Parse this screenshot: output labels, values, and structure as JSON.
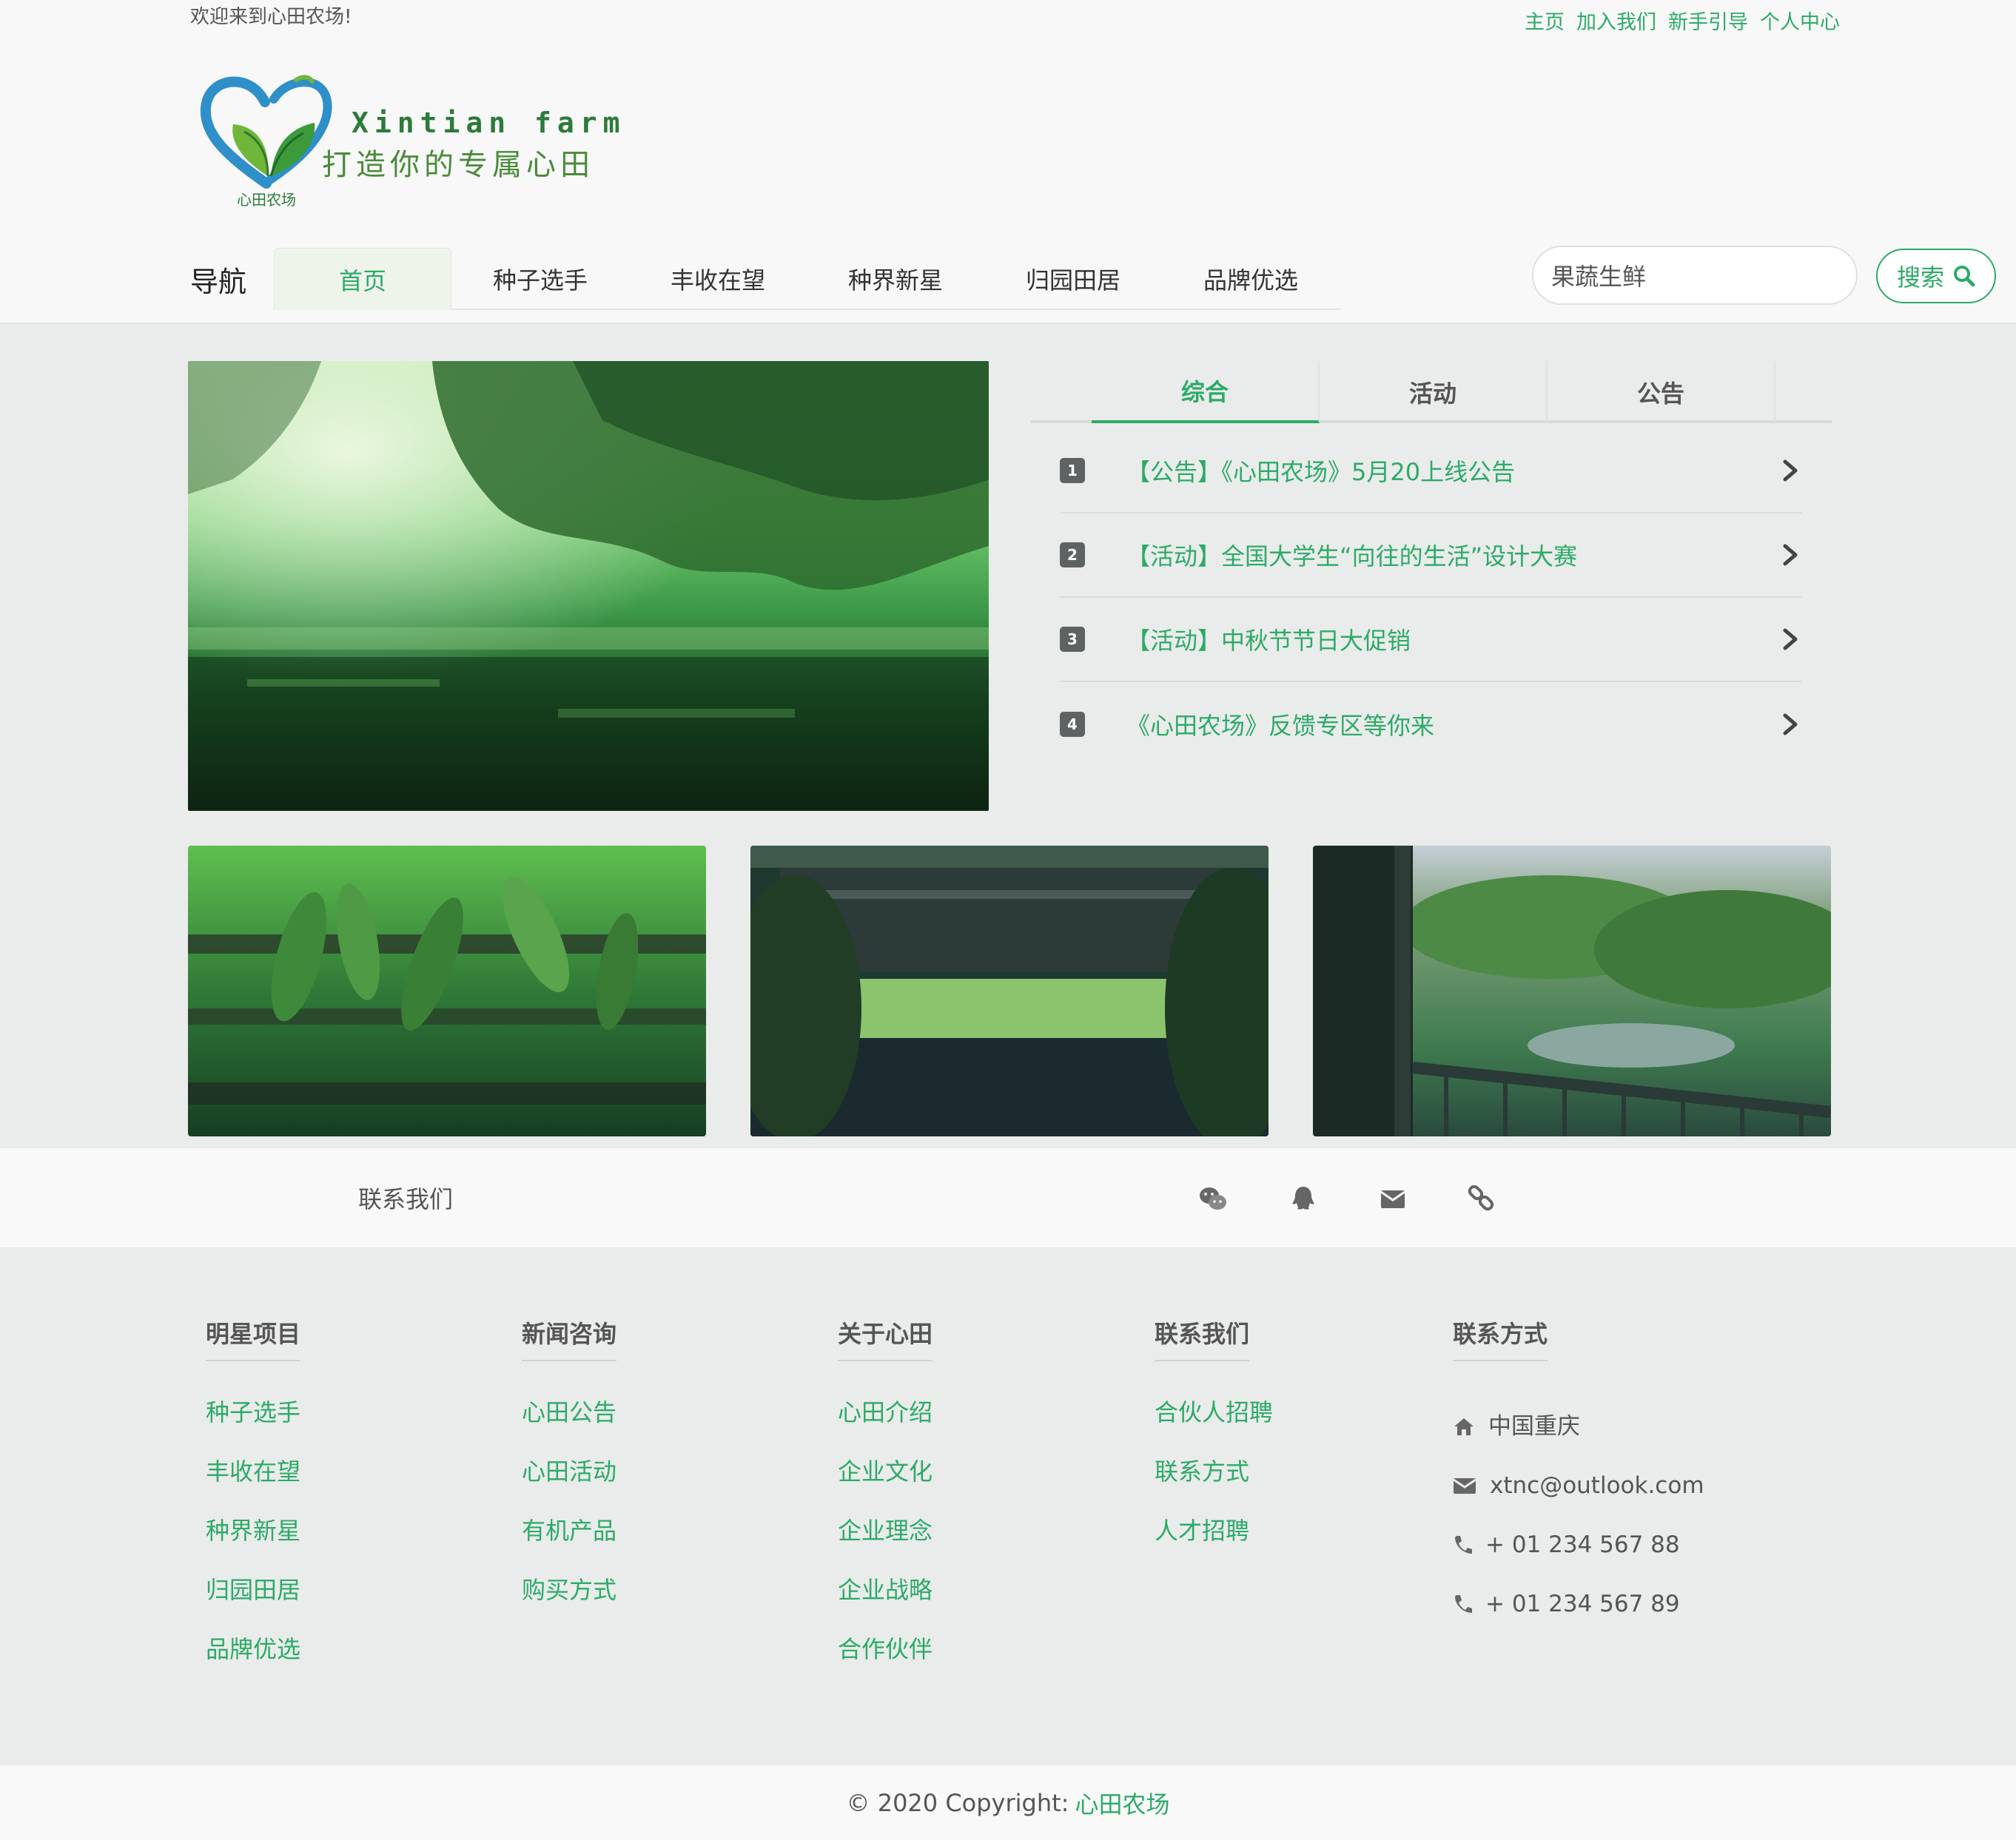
{
  "header": {
    "welcome": "欢迎来到心田农场!",
    "top_links": [
      "主页",
      "加入我们",
      "新手引导",
      "个人中心"
    ],
    "logo": {
      "en": "Xintian farm",
      "slogan": "打造你的专属心田",
      "sub": "心田农场"
    },
    "nav_label": "导航",
    "nav": [
      "首页",
      "种子选手",
      "丰收在望",
      "种界新星",
      "归园田居",
      "品牌优选"
    ],
    "active_nav": "首页",
    "search": {
      "value": "果蔬生鲜",
      "button": "搜索"
    }
  },
  "tabs": [
    "综合",
    "活动",
    "公告"
  ],
  "active_tab": "综合",
  "news": [
    {
      "num": "1",
      "text": "【公告】《心田农场》5月20上线公告"
    },
    {
      "num": "2",
      "text": "【活动】全国大学生“向往的生活”设计大赛"
    },
    {
      "num": "3",
      "text": "【活动】中秋节节日大促销"
    },
    {
      "num": "4",
      "text": "《心田农场》反馈专区等你来"
    }
  ],
  "contact_bar": {
    "label": "联系我们",
    "icons": [
      "wechat-icon",
      "qq-icon",
      "envelope-icon",
      "link-icon"
    ]
  },
  "footer": {
    "col1": {
      "title": "明星项目",
      "links": [
        "种子选手",
        "丰收在望",
        "种界新星",
        "归园田居",
        "品牌优选"
      ]
    },
    "col2": {
      "title": "新闻咨询",
      "links": [
        "心田公告",
        "心田活动",
        "有机产品",
        "购买方式"
      ]
    },
    "col3": {
      "title": "关于心田",
      "links": [
        "心田介绍",
        "企业文化",
        "企业理念",
        "企业战略",
        "合作伙伴"
      ]
    },
    "col4": {
      "title": "联系我们",
      "links": [
        "合伙人招聘",
        "联系方式",
        "人才招聘"
      ]
    },
    "col5": {
      "title": "联系方式",
      "items": [
        {
          "icon": "home-icon",
          "text": "中国重庆"
        },
        {
          "icon": "envelope-icon",
          "text": "xtnc@outlook.com"
        },
        {
          "icon": "phone-icon",
          "text": "+ 01 234 567 88"
        },
        {
          "icon": "phone-icon",
          "text": "+ 01 234 567 89"
        }
      ]
    }
  },
  "copyright": {
    "text": "© 2020 Copyright:",
    "brand": "心田农场"
  },
  "colors": {
    "accent": "#2daa68",
    "background": "#e9ecea",
    "header_bg": "#f7f8f7"
  }
}
